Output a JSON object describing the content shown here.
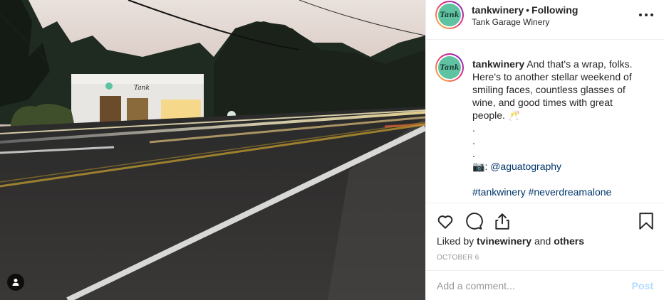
{
  "header": {
    "avatar_text": "Tank",
    "username": "tankwinery",
    "separator": "•",
    "follow_status": "Following",
    "location": "Tank Garage Winery"
  },
  "caption": {
    "avatar_text": "Tank",
    "username": "tankwinery",
    "text": "And that's a wrap, folks. Here's to another stellar weekend of smiling faces, countless glasses of wine, and good times with great people. 🥂",
    "dots": [
      ".",
      ".",
      "."
    ],
    "camera_emoji": "📷",
    "credit_prefix": ":",
    "credit_link": "@aguatography",
    "hashtags": [
      "#tankwinery",
      "#neverdreamalone"
    ]
  },
  "actions": {
    "like_icon": "heart-icon",
    "comment_icon": "speech-bubble-icon",
    "share_icon": "share-icon",
    "save_icon": "bookmark-icon"
  },
  "likes": {
    "prefix": "Liked by",
    "user": "tvinewinery",
    "connector": "and",
    "others": "others"
  },
  "date": "OCTOBER 6",
  "comment_box": {
    "placeholder": "Add a comment...",
    "post_label": "Post"
  },
  "photo": {
    "user_tag_icon": "person-icon"
  },
  "colors": {
    "link": "#003569",
    "post_disabled": "#b3dbff",
    "muted": "#999999",
    "logo_teal": "#5fc3a2"
  }
}
